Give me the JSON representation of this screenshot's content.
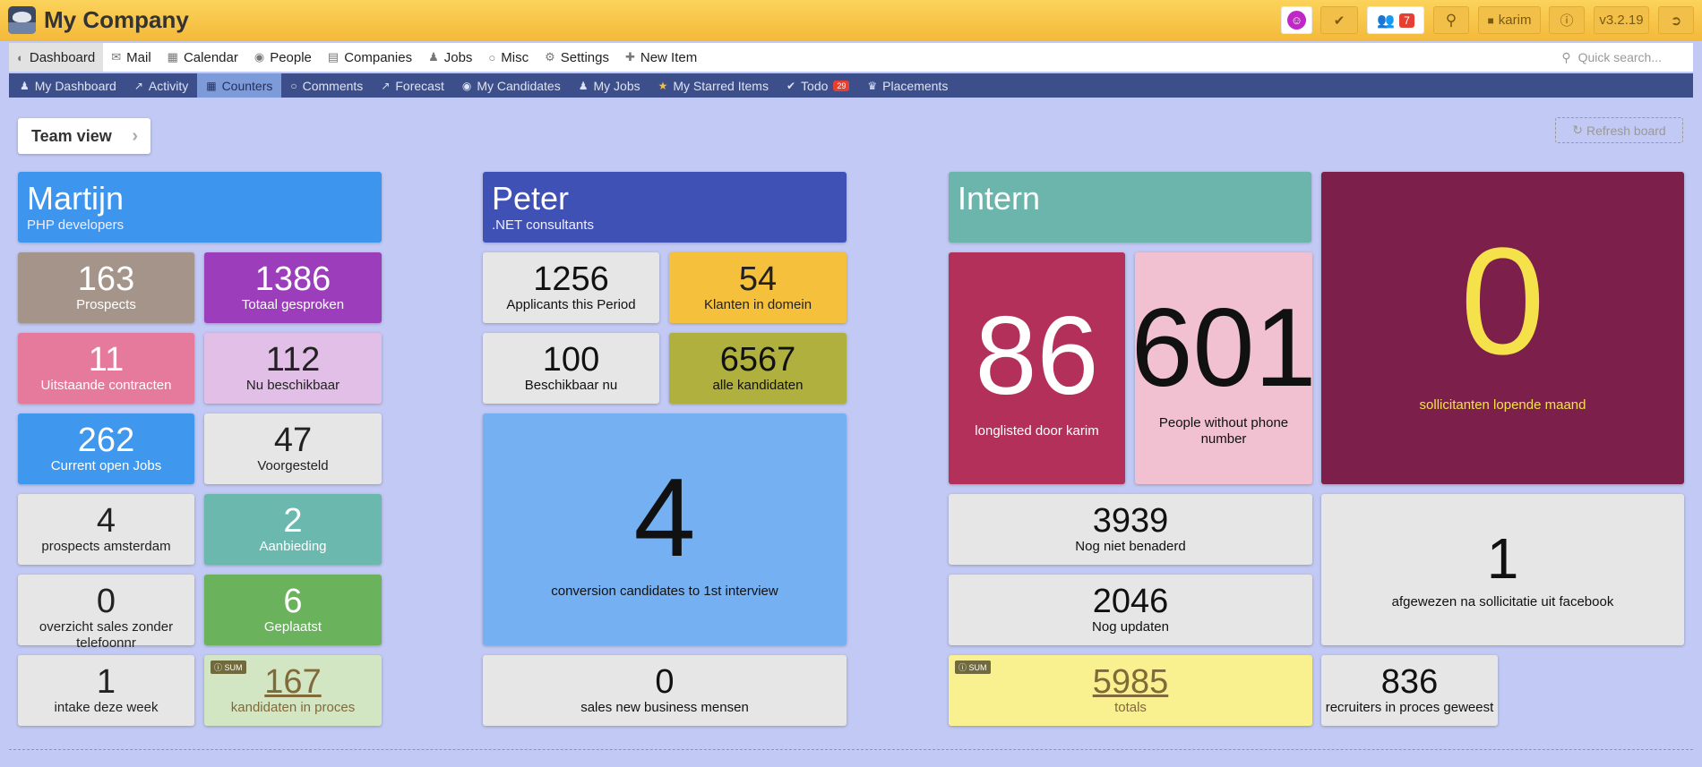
{
  "app": {
    "company": "My Company",
    "version": "v3.2.19",
    "user": "karim",
    "user_badge": "7"
  },
  "nav1": [
    {
      "label": "Dashboard",
      "icon": "dashboard-icon"
    },
    {
      "label": "Mail",
      "icon": "mail-icon"
    },
    {
      "label": "Calendar",
      "icon": "calendar-icon"
    },
    {
      "label": "People",
      "icon": "people-icon"
    },
    {
      "label": "Companies",
      "icon": "companies-icon"
    },
    {
      "label": "Jobs",
      "icon": "jobs-icon"
    },
    {
      "label": "Misc",
      "icon": "misc-icon"
    },
    {
      "label": "Settings",
      "icon": "settings-icon"
    },
    {
      "label": "New Item",
      "icon": "plus-icon"
    }
  ],
  "search": {
    "placeholder": "Quick search..."
  },
  "nav2": [
    {
      "label": "My Dashboard",
      "icon": "user-icon"
    },
    {
      "label": "Activity",
      "icon": "chart-line-icon"
    },
    {
      "label": "Counters",
      "icon": "grid-icon"
    },
    {
      "label": "Comments",
      "icon": "comments-icon"
    },
    {
      "label": "Forecast",
      "icon": "chart-line-icon"
    },
    {
      "label": "My Candidates",
      "icon": "people-icon"
    },
    {
      "label": "My Jobs",
      "icon": "jobs-icon"
    },
    {
      "label": "My Starred Items",
      "icon": "star-icon"
    },
    {
      "label": "Todo",
      "icon": "check-icon",
      "badge": "29"
    },
    {
      "label": "Placements",
      "icon": "trophy-icon"
    }
  ],
  "board": {
    "team_view": "Team view",
    "refresh": "Refresh board",
    "sum_label": "SUM"
  },
  "groups": {
    "martijn": {
      "title": "Martijn",
      "subtitle": "PHP developers"
    },
    "peter": {
      "title": "Peter",
      "subtitle": ".NET consultants"
    },
    "intern": {
      "title": "Intern",
      "subtitle": ""
    }
  },
  "martijn": [
    {
      "value": "163",
      "label": "Prospects",
      "color": "#a4948a"
    },
    {
      "value": "1386",
      "label": "Totaal gesproken",
      "color": "#9c3dbb"
    },
    {
      "value": "11",
      "label": "Uitstaande contracten",
      "color": "#e57a9c"
    },
    {
      "value": "112",
      "label": "Nu beschikbaar",
      "color": "#e1bfe6"
    },
    {
      "value": "262",
      "label": "Current open Jobs",
      "color": "#3f97ee"
    },
    {
      "value": "47",
      "label": "Voorgesteld",
      "color": "#e6e6e6"
    },
    {
      "value": "4",
      "label": "prospects amsterdam",
      "color": "#e6e6e6"
    },
    {
      "value": "2",
      "label": "Aanbieding",
      "color": "#6bb9ae"
    },
    {
      "value": "0",
      "label": "overzicht sales zonder telefoonnr",
      "color": "#e6e6e6"
    },
    {
      "value": "6",
      "label": "Geplaatst",
      "color": "#6ab35c"
    },
    {
      "value": "1",
      "label": "intake deze week",
      "color": "#e6e6e6"
    },
    {
      "value": "167",
      "label": "kandidaten in proces",
      "color": "#d3e6c4"
    }
  ],
  "peter": [
    {
      "value": "1256",
      "label": "Applicants this Period",
      "color": "#e6e6e6"
    },
    {
      "value": "54",
      "label": "Klanten in domein",
      "color": "#f5c13c"
    },
    {
      "value": "100",
      "label": "Beschikbaar nu",
      "color": "#e6e6e6"
    },
    {
      "value": "6567",
      "label": "alle kandidaten",
      "color": "#afb03e"
    },
    {
      "value": "4",
      "label": "conversion candidates to 1st interview",
      "color": "#75b0f2"
    },
    {
      "value": "0",
      "label": "sales new business mensen",
      "color": "#e6e6e6"
    }
  ],
  "intern": [
    {
      "value": "86",
      "label": "longlisted door karim",
      "color": "#b3305a"
    },
    {
      "value": "601",
      "label": "People without phone number",
      "color": "#f1c0d1"
    },
    {
      "value": "0",
      "label": "sollicitanten lopende maand",
      "color": "#7c1f4a"
    },
    {
      "value": "3939",
      "label": "Nog niet benaderd",
      "color": "#e6e6e6"
    },
    {
      "value": "2046",
      "label": "Nog updaten",
      "color": "#e6e6e6"
    },
    {
      "value": "1",
      "label": "afgewezen na sollicitatie uit facebook",
      "color": "#e6e6e6"
    },
    {
      "value": "5985",
      "label": "totals",
      "color": "#f9f08f"
    },
    {
      "value": "836",
      "label": "recruiters in proces geweest",
      "color": "#e6e6e6"
    }
  ]
}
